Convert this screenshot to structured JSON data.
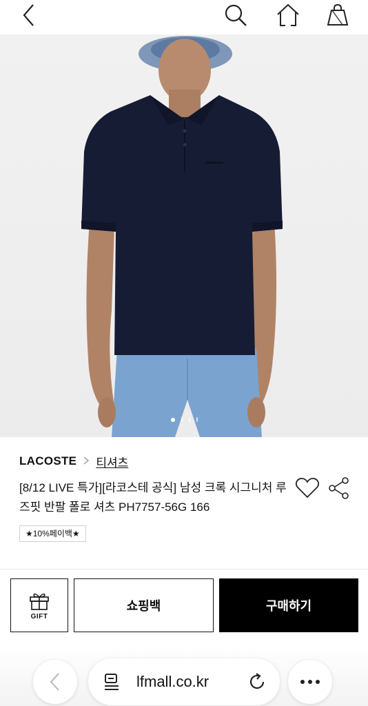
{
  "nav": {
    "icons": [
      "back-icon",
      "search-icon",
      "home-icon",
      "shopping-bag-icon"
    ]
  },
  "product": {
    "brand": "LACOSTE",
    "category": "티셔츠",
    "title": "[8/12 LIVE 특가][라코스테 공식] 남성 크록 시그니처 루즈핏 반팔 폴로 셔츠 PH7757-56G 166",
    "badge": "★10%페이백★",
    "image_count": 4,
    "current_image": 1
  },
  "actions": {
    "gift_label": "GIFT",
    "cart_label": "쇼핑백",
    "buy_label": "구매하기"
  },
  "browser": {
    "url": "lfmall.co.kr"
  },
  "colors": {
    "primary": "#000000",
    "shirt": "#161c34",
    "shorts": "#7aa3d0",
    "background": "#f0f0f0"
  }
}
